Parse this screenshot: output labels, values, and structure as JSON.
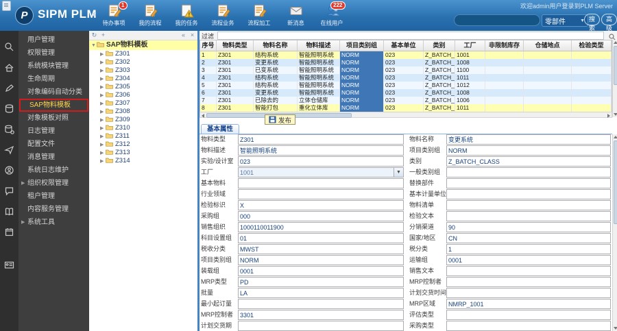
{
  "header": {
    "app_title": "SIPM PLM",
    "welcome_text": "欢迎admin用户登录到PLM Server",
    "toolbar": [
      {
        "label": "待办事项",
        "icon": "doc-pencil",
        "badge": "1"
      },
      {
        "label": "我的流程",
        "icon": "doc-pencil",
        "badge": ""
      },
      {
        "label": "我的任务",
        "icon": "doc-warning",
        "badge": ""
      },
      {
        "label": "流程业务",
        "icon": "doc-pencil",
        "badge": ""
      },
      {
        "label": "流程加工",
        "icon": "doc-pencil",
        "badge": ""
      },
      {
        "label": "新消息",
        "icon": "envelope",
        "badge": ""
      },
      {
        "label": "在线用户",
        "icon": "users",
        "badge": "222"
      }
    ],
    "search": {
      "value": "",
      "category": "零部件",
      "search_button": "搜索",
      "advanced_button": "高级"
    }
  },
  "rail": {
    "icons": [
      "search",
      "home",
      "edit",
      "database",
      "database-gear",
      "send",
      "support",
      "chat",
      "book",
      "calendar",
      "id-card"
    ]
  },
  "sidebar": {
    "items": [
      {
        "label": "用户管理",
        "active": false,
        "expandable": false
      },
      {
        "label": "权限管理",
        "active": false,
        "expandable": false
      },
      {
        "label": "系统模块管理",
        "active": false,
        "expandable": false
      },
      {
        "label": "生命周期",
        "active": false,
        "expandable": false
      },
      {
        "label": "对象编码自动分类",
        "active": false,
        "expandable": false
      },
      {
        "label": "SAP物料模板",
        "active": true,
        "expandable": false
      },
      {
        "label": "对象模板对照",
        "active": false,
        "expandable": false
      },
      {
        "label": "日志管理",
        "active": false,
        "expandable": false
      },
      {
        "label": "配置文件",
        "active": false,
        "expandable": false
      },
      {
        "label": "消息管理",
        "active": false,
        "expandable": false
      },
      {
        "label": "系统日志维护",
        "active": false,
        "expandable": false
      },
      {
        "label": "组织权限管理",
        "active": false,
        "expandable": true
      },
      {
        "label": "租户管理",
        "active": false,
        "expandable": false
      },
      {
        "label": "内容服务管理",
        "active": false,
        "expandable": false
      },
      {
        "label": "系统工具",
        "active": false,
        "expandable": true
      }
    ]
  },
  "tree": {
    "root": "SAP物料模板",
    "nodes": [
      "Z301",
      "Z302",
      "Z303",
      "Z304",
      "Z305",
      "Z306",
      "Z307",
      "Z308",
      "Z309",
      "Z310",
      "Z311",
      "Z312",
      "Z313",
      "Z314"
    ]
  },
  "main": {
    "filter_label": "过滤",
    "table": {
      "columns": [
        "序号",
        "物料类型",
        "物料名称",
        "物料描述",
        "项目类别组",
        "基本单位",
        "类别",
        "工厂",
        "非限制库存",
        "仓储地点",
        "检验类型"
      ],
      "selected_column": "项目类别组",
      "rows": [
        {
          "selected": true,
          "cells": [
            "1",
            "Z301",
            "结构系统",
            "智能照明系统",
            "NORM",
            "023",
            "Z_BATCH_CLA..",
            "1001",
            "",
            "",
            ""
          ]
        },
        {
          "selected": false,
          "cells": [
            "2",
            "Z301",
            "变更系统",
            "智能照明系统",
            "NORM",
            "023",
            "Z_BATCH_CLA..",
            "1008",
            "",
            "",
            ""
          ]
        },
        {
          "selected": false,
          "cells": [
            "3",
            "Z301",
            "已变系统",
            "智能照明系统",
            "NORM",
            "023",
            "Z_BATCH_CLA..",
            "1100",
            "",
            "",
            ""
          ]
        },
        {
          "selected": false,
          "cells": [
            "4",
            "Z301",
            "结构系统",
            "智能照明系统",
            "NORM",
            "023",
            "Z_BATCH_CLA..",
            "1011",
            "",
            "",
            ""
          ]
        },
        {
          "selected": false,
          "cells": [
            "5",
            "Z301",
            "结构系统",
            "智能照明系统",
            "NORM",
            "023",
            "Z_BATCH_CLA..",
            "1012",
            "",
            "",
            ""
          ]
        },
        {
          "selected": false,
          "cells": [
            "6",
            "Z301",
            "变更系统",
            "智能照明系统",
            "NORM",
            "023",
            "Z_BATCH_CLA..",
            "1008",
            "",
            "",
            ""
          ]
        },
        {
          "selected": false,
          "cells": [
            "7",
            "Z301",
            "已除去的",
            "立体仓储库",
            "NORM",
            "023",
            "Z_BATCH_CLA..",
            "1006",
            "",
            "",
            ""
          ]
        },
        {
          "selected": true,
          "cells": [
            "8",
            "Z301",
            "智能打包",
            "重化立体库",
            "NORM",
            "023",
            "Z_BATCH_CLA..",
            "1011",
            "",
            "",
            ""
          ]
        }
      ]
    },
    "save_button": "发布",
    "tab": "基本属性",
    "form": {
      "left": [
        {
          "label": "物料类型",
          "value": "Z301",
          "control": "input"
        },
        {
          "label": "物料描述",
          "value": "智能照明系统",
          "control": "input"
        },
        {
          "label": "实验/设计室",
          "value": "023",
          "control": "input"
        },
        {
          "label": "工厂",
          "value": "1001",
          "control": "select"
        },
        {
          "label": "基本物料",
          "value": "",
          "control": "input"
        },
        {
          "label": "行业领域",
          "value": "",
          "control": "input"
        },
        {
          "label": "检验标识",
          "value": "X",
          "control": "input"
        },
        {
          "label": "采购组",
          "value": "000",
          "control": "input"
        },
        {
          "label": "销售组织",
          "value": "1000110011900",
          "control": "input"
        },
        {
          "label": "科目设置组",
          "value": "01",
          "control": "input"
        },
        {
          "label": "税收分类",
          "value": "MWST",
          "control": "input"
        },
        {
          "label": "项目类别组",
          "value": "NORM",
          "control": "input"
        },
        {
          "label": "装载组",
          "value": "0001",
          "control": "input"
        },
        {
          "label": "MRP类型",
          "value": "PD",
          "control": "input"
        },
        {
          "label": "批量",
          "value": "LA",
          "control": "input"
        },
        {
          "label": "最小起订量",
          "value": "",
          "control": "input"
        },
        {
          "label": "MRP控制者",
          "value": "3301",
          "control": "input"
        },
        {
          "label": "计划交货期",
          "value": "",
          "control": "input"
        }
      ],
      "right": [
        {
          "label": "物料名称",
          "value": "变更系统",
          "control": "input"
        },
        {
          "label": "项目类别组",
          "value": "NORM",
          "control": "input"
        },
        {
          "label": "类别",
          "value": "Z_BATCH_CLASS",
          "control": "input"
        },
        {
          "label": "一般类别组",
          "value": "",
          "control": "input"
        },
        {
          "label": "替换部件",
          "value": "",
          "control": "input"
        },
        {
          "label": "基本计量单位",
          "value": "",
          "control": "input"
        },
        {
          "label": "物料清单",
          "value": "",
          "control": "input"
        },
        {
          "label": "检验文本",
          "value": "",
          "control": "input"
        },
        {
          "label": "分销渠道",
          "value": "90",
          "control": "input"
        },
        {
          "label": "国家/地区",
          "value": "CN",
          "control": "input"
        },
        {
          "label": "税分类",
          "value": "1",
          "control": "input"
        },
        {
          "label": "运输组",
          "value": "0001",
          "control": "input"
        },
        {
          "label": "销售文本",
          "value": "",
          "control": "input"
        },
        {
          "label": "MRP控制者",
          "value": "",
          "control": "input"
        },
        {
          "label": "计划交货时间",
          "value": "",
          "control": "input"
        },
        {
          "label": "MRP区域",
          "value": "NMRP_1001",
          "control": "input"
        },
        {
          "label": "评估类型",
          "value": "",
          "control": "input"
        },
        {
          "label": "采购类型",
          "value": "",
          "control": "input"
        }
      ]
    }
  },
  "colors": {
    "header_blue": "#2a71b0",
    "sidebar_dark": "#3e3e3e",
    "active_item_yellow": "#ffd24a",
    "annotation_red": "#cf1d1d",
    "selected_row_yellow": "#ffffb4",
    "selected_column_blue": "#3f76b5",
    "row_alt_blue": "#d6eafc"
  }
}
